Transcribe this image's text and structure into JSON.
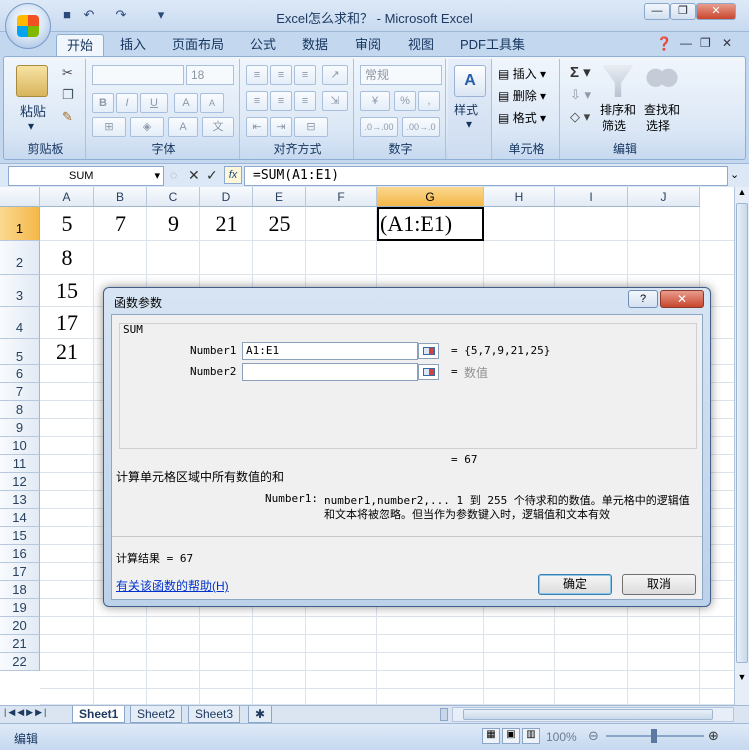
{
  "window": {
    "title": "Excel怎么求和？ - Microsoft Excel"
  },
  "ribbon_tabs": [
    "开始",
    "插入",
    "页面布局",
    "公式",
    "数据",
    "审阅",
    "视图",
    "PDF工具集"
  ],
  "ribbon": {
    "clipboard": {
      "label": "剪贴板",
      "paste": "粘贴"
    },
    "font": {
      "label": "字体",
      "size": "18"
    },
    "alignment": {
      "label": "对齐方式"
    },
    "number": {
      "label": "数字",
      "format": "常规"
    },
    "styles": {
      "label": "样式"
    },
    "cells": {
      "label": "单元格",
      "insert": "插入",
      "delete": "删除",
      "format": "格式"
    },
    "editing": {
      "label": "编辑",
      "sort_filter_1": "排序和",
      "sort_filter_2": "筛选",
      "find_select_1": "查找和",
      "find_select_2": "选择"
    }
  },
  "formula_bar": {
    "name_box": "SUM",
    "formula": "=SUM(A1:E1)"
  },
  "columns": [
    "A",
    "B",
    "C",
    "D",
    "E",
    "F",
    "G",
    "H",
    "I",
    "J"
  ],
  "selected_column": "G",
  "rows": [
    "1",
    "2",
    "3",
    "4",
    "5",
    "6",
    "7",
    "8",
    "9",
    "10",
    "11",
    "12",
    "13",
    "14",
    "15",
    "16",
    "17",
    "18",
    "19",
    "20",
    "21",
    "22"
  ],
  "cells": {
    "A1": "5",
    "B1": "7",
    "C1": "9",
    "D1": "21",
    "E1": "25",
    "G1": "(A1:E1)",
    "A2": "8",
    "A3": "15",
    "A4": "17",
    "A5": "21"
  },
  "sheets": [
    "Sheet1",
    "Sheet2",
    "Sheet3"
  ],
  "status": {
    "mode": "编辑",
    "zoom": "100%"
  },
  "dialog": {
    "title": "函数参数",
    "function_name": "SUM",
    "arg1_label": "Number1",
    "arg1_value": "A1:E1",
    "arg1_result": "=  {5,7,9,21,25}",
    "arg2_label": "Number2",
    "arg2_value": "",
    "arg2_result_eq": "=",
    "arg2_result": "数值",
    "total": "=  67",
    "description": "计算单元格区域中所有数值的和",
    "arg_help_label": "Number1:",
    "arg_help_line1": "number1,number2,...  1 到 255 个待求和的数值。单元格中的逻辑值",
    "arg_help_line2": "和文本将被忽略。但当作为参数键入时，逻辑值和文本有效",
    "result": "计算结果 =  67",
    "help_link": "有关该函数的帮助(H)",
    "ok": "确定",
    "cancel": "取消"
  }
}
